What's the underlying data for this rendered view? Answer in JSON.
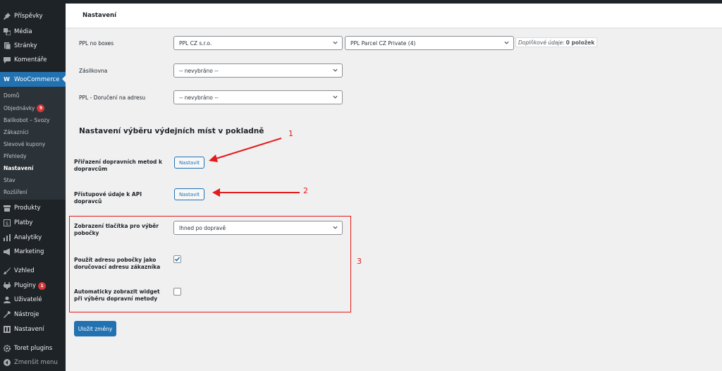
{
  "sidebar": {
    "items": [
      {
        "label": "Příspěvky",
        "icon": "pin-icon"
      },
      {
        "label": "Média",
        "icon": "media-icon"
      },
      {
        "label": "Stránky",
        "icon": "page-icon"
      },
      {
        "label": "Komentáře",
        "icon": "comment-icon"
      },
      {
        "label": "WooCommerce",
        "icon": "woocommerce-icon"
      },
      {
        "label": "Produkty",
        "icon": "archive-icon"
      },
      {
        "label": "Platby",
        "icon": "dollar-icon"
      },
      {
        "label": "Analytiky",
        "icon": "bar-chart-icon"
      },
      {
        "label": "Marketing",
        "icon": "megaphone-icon"
      },
      {
        "label": "Vzhled",
        "icon": "brush-icon"
      },
      {
        "label": "Pluginy",
        "icon": "plugin-icon",
        "badge": "1"
      },
      {
        "label": "Uživatelé",
        "icon": "user-icon"
      },
      {
        "label": "Nástroje",
        "icon": "wrench-icon"
      },
      {
        "label": "Nastavení",
        "icon": "settings-icon"
      },
      {
        "label": "Toret plugins",
        "icon": "gear-icon"
      },
      {
        "label": "Zmenšit menu",
        "icon": "collapse-icon"
      }
    ],
    "submenu": [
      {
        "label": "Domů"
      },
      {
        "label": "Objednávky",
        "badge": "9"
      },
      {
        "label": "Balíkobot – Svozy"
      },
      {
        "label": "Zákazníci"
      },
      {
        "label": "Slevové kupony"
      },
      {
        "label": "Přehledy"
      },
      {
        "label": "Nastavení"
      },
      {
        "label": "Stav"
      },
      {
        "label": "Rozšíření"
      }
    ]
  },
  "header": {
    "title": "Nastavení"
  },
  "form": {
    "ppl_no_boxes": {
      "label": "PPL no boxes",
      "carrier_value": "PPL CZ s.r.o.",
      "service_value": "PPL Parcel CZ Private (4)",
      "extra_label": "Doplňkové údaje:",
      "extra_value": "0 položek"
    },
    "zasilkovna": {
      "label": "Zásilkovna",
      "value": "-- nevybráno --"
    },
    "ppl_home": {
      "label": "PPL - Doručení na adresu",
      "value": "-- nevybráno --"
    },
    "section_title": "Nastavení výběru výdejních míst v pokladně",
    "assign_methods": {
      "label_line1": "Přiřazení dopravních metod k",
      "label_line2": "dopravcům",
      "button": "Nastavit"
    },
    "api_access": {
      "label_line1": "Přístupové údaje k API",
      "label_line2": "dopravců",
      "button": "Nastavit"
    },
    "button_display": {
      "label_line1": "Zobrazení tlačítka pro výběr",
      "label_line2": "pobočky",
      "value": "Ihned po dopravě"
    },
    "use_branch_address": {
      "label_line1": "Použít adresu pobočky jako",
      "label_line2": "doručovací adresu zákazníka",
      "checked": true
    },
    "auto_widget": {
      "label_line1": "Automaticky zobrazit widget",
      "label_line2": "při výběru dopravní metody",
      "checked": false
    },
    "save_button": "Uložit změny"
  },
  "annotations": {
    "n1": "1",
    "n2": "2",
    "n3": "3"
  },
  "colors": {
    "accent": "#2271b1",
    "sidebar_bg": "#1d2327",
    "annotation": "#e31b1b",
    "badge": "#d63638"
  }
}
